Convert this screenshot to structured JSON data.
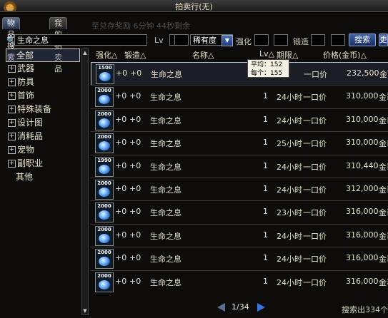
{
  "window": {
    "title": "拍卖行(无)"
  },
  "tabs": [
    {
      "label": "物品搜索",
      "active": true
    },
    {
      "label": "我的拍卖品",
      "active": false
    }
  ],
  "background_ghost": {
    "line1": "...",
    "line2": "至兑存奖励 6分钟 44秒剩余"
  },
  "search": {
    "query": "生命之息",
    "level_label": "Lv",
    "level_min": "",
    "level_max": "",
    "rarity_value": "稀有度",
    "enhance_label": "强化",
    "enhance_value": "",
    "forge_label": "锻造",
    "forge_value": "",
    "search_button": "搜索",
    "extra_button": "更"
  },
  "categories": [
    {
      "label": "全部",
      "selected": true,
      "has_plus": false
    },
    {
      "label": "武器",
      "has_plus": true
    },
    {
      "label": "防具",
      "has_plus": true
    },
    {
      "label": "首饰",
      "has_plus": true
    },
    {
      "label": "特殊装备",
      "has_plus": true
    },
    {
      "label": "设计图",
      "has_plus": true
    },
    {
      "label": "消耗品",
      "has_plus": true
    },
    {
      "label": "宠物",
      "has_plus": true
    },
    {
      "label": "副职业",
      "has_plus": true
    },
    {
      "label": "其他",
      "has_plus": false
    }
  ],
  "columns": {
    "enhance": "强化△",
    "forge": "锻造△",
    "name": "名称△",
    "level": "Lv△",
    "period": "期限△",
    "price": "价格(金币)△"
  },
  "rows": [
    {
      "icon_text": "1500",
      "enhance": "+0",
      "forge": "+0",
      "name": "生命之息",
      "level": "",
      "period": "时",
      "price_type": "一口价",
      "price": "232,500",
      "unit": "金币"
    },
    {
      "icon_text": "2000",
      "enhance": "+0",
      "forge": "+0",
      "name": "生命之息",
      "level": "1",
      "period": "24小时",
      "price_type": "一口价",
      "price": "310,000",
      "unit": "金币"
    },
    {
      "icon_text": "2000",
      "enhance": "+0",
      "forge": "+0",
      "name": "生命之息",
      "level": "1",
      "period": "24小时",
      "price_type": "一口价",
      "price": "310,000",
      "unit": "金币"
    },
    {
      "icon_text": "2000",
      "enhance": "+0",
      "forge": "+0",
      "name": "生命之息",
      "level": "1",
      "period": "25小时",
      "price_type": "一口价",
      "price": "310,000",
      "unit": "金币"
    },
    {
      "icon_text": "1990",
      "enhance": "+0",
      "forge": "+0",
      "name": "生命之息",
      "level": "1",
      "period": "24小时",
      "price_type": "一口价",
      "price": "310,440",
      "unit": "金币"
    },
    {
      "icon_text": "2000",
      "enhance": "+0",
      "forge": "+0",
      "name": "生命之息",
      "level": "1",
      "period": "24小时",
      "price_type": "一口价",
      "price": "312,000",
      "unit": "金币"
    },
    {
      "icon_text": "2000",
      "enhance": "+0",
      "forge": "+0",
      "name": "生命之息",
      "level": "1",
      "period": "23小时",
      "price_type": "一口价",
      "price": "316,000",
      "unit": "金币"
    },
    {
      "icon_text": "2000",
      "enhance": "+0",
      "forge": "+0",
      "name": "生命之息",
      "level": "1",
      "period": "24小时",
      "price_type": "一口价",
      "price": "316,000",
      "unit": "金币"
    },
    {
      "icon_text": "2000",
      "enhance": "+0",
      "forge": "+0",
      "name": "生命之息",
      "level": "1",
      "period": "24小时",
      "price_type": "一口价",
      "price": "316,000",
      "unit": "金币"
    },
    {
      "icon_text": "2000",
      "enhance": "+0",
      "forge": "+0",
      "name": "生命之息",
      "level": "1",
      "period": "24小时",
      "price_type": "一口价",
      "price": "316,000",
      "unit": "金币"
    }
  ],
  "tooltip": {
    "avg": "平均：152",
    "each": "每个：155"
  },
  "pager": {
    "text": "1/34"
  },
  "footer": {
    "count_text": "搜索出334个"
  },
  "colors": {
    "accent_blue": "#3a5ea8",
    "title_text": "#f0e6c8"
  }
}
